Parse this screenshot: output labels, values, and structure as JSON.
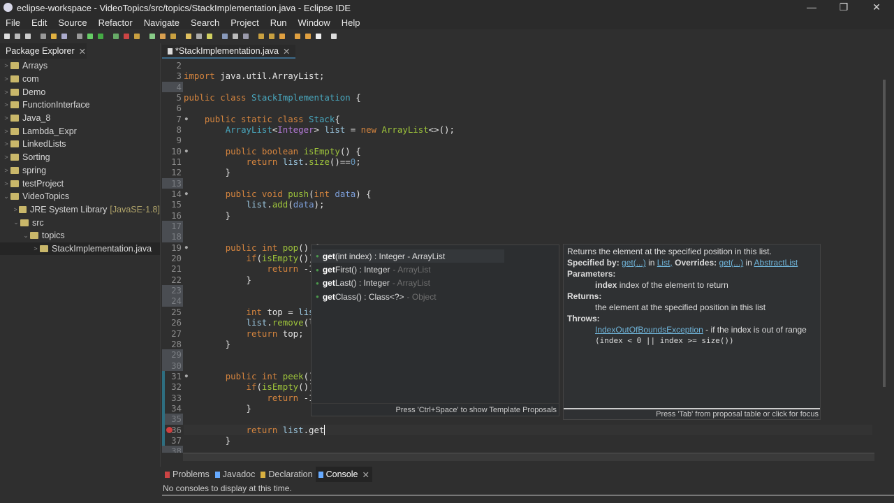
{
  "window": {
    "title": "eclipse-workspace - VideoTopics/src/topics/StackImplementation.java - Eclipse IDE",
    "minimize": "—",
    "restore": "❐",
    "close": "✕"
  },
  "menu": [
    "File",
    "Edit",
    "Source",
    "Refactor",
    "Navigate",
    "Search",
    "Project",
    "Run",
    "Window",
    "Help"
  ],
  "package_explorer": {
    "title": "Package Explorer",
    "items": [
      {
        "label": "Arrays",
        "depth": 0,
        "exp": ">"
      },
      {
        "label": "com",
        "depth": 0,
        "exp": ">"
      },
      {
        "label": "Demo",
        "depth": 0,
        "exp": ">"
      },
      {
        "label": "FunctionInterface",
        "depth": 0,
        "exp": ">"
      },
      {
        "label": "Java_8",
        "depth": 0,
        "exp": ">"
      },
      {
        "label": "Lambda_Expr",
        "depth": 0,
        "exp": ">"
      },
      {
        "label": "LinkedLists",
        "depth": 0,
        "exp": ">"
      },
      {
        "label": "Sorting",
        "depth": 0,
        "exp": ">"
      },
      {
        "label": "spring",
        "depth": 0,
        "exp": ">"
      },
      {
        "label": "testProject",
        "depth": 0,
        "exp": ">"
      },
      {
        "label": "VideoTopics",
        "depth": 0,
        "exp": "⌄"
      },
      {
        "label": "JRE System Library",
        "deco": "[JavaSE-1.8]",
        "depth": 1,
        "exp": ">"
      },
      {
        "label": "src",
        "depth": 1,
        "exp": "⌄"
      },
      {
        "label": "topics",
        "depth": 2,
        "exp": "⌄"
      },
      {
        "label": "StackImplementation.java",
        "depth": 3,
        "exp": ">"
      }
    ]
  },
  "editor": {
    "tab": "*StackImplementation.java",
    "first_line": 2,
    "highlighted_lines": [
      4,
      13,
      17,
      18,
      23,
      24,
      29,
      30,
      35,
      38
    ],
    "fold_markers": [
      7,
      10,
      14,
      19,
      31
    ],
    "error_line": 36,
    "lines": [
      [],
      [
        [
          "k",
          "import"
        ],
        [
          "p",
          " java.util.ArrayList;"
        ]
      ],
      [],
      [
        [
          "k",
          "public class "
        ],
        [
          "t",
          "StackImplementation"
        ],
        [
          "p",
          " {"
        ]
      ],
      [],
      [
        [
          "p",
          "    "
        ],
        [
          "k",
          "public static class "
        ],
        [
          "t",
          "Stack"
        ],
        [
          "p",
          "{"
        ]
      ],
      [
        [
          "p",
          "        "
        ],
        [
          "t",
          "ArrayList"
        ],
        [
          "p",
          "<"
        ],
        [
          "g",
          "Integer"
        ],
        [
          "p",
          "> "
        ],
        [
          "v",
          "list"
        ],
        [
          "p",
          " = "
        ],
        [
          "k",
          "new "
        ],
        [
          "m",
          "ArrayList"
        ],
        [
          "p",
          "<>();"
        ]
      ],
      [],
      [
        [
          "p",
          "        "
        ],
        [
          "k",
          "public boolean "
        ],
        [
          "m",
          "isEmpty"
        ],
        [
          "p",
          "() {"
        ]
      ],
      [
        [
          "p",
          "            "
        ],
        [
          "k",
          "return "
        ],
        [
          "v",
          "list"
        ],
        [
          "p",
          "."
        ],
        [
          "m",
          "size"
        ],
        [
          "p",
          "()=="
        ],
        [
          "n",
          "0"
        ],
        [
          "p",
          ";"
        ]
      ],
      [
        [
          "p",
          "        }"
        ]
      ],
      [],
      [
        [
          "p",
          "        "
        ],
        [
          "k",
          "public void "
        ],
        [
          "m",
          "push"
        ],
        [
          "p",
          "("
        ],
        [
          "k",
          "int "
        ],
        [
          "a",
          "data"
        ],
        [
          "p",
          ") {"
        ]
      ],
      [
        [
          "p",
          "            "
        ],
        [
          "v",
          "list"
        ],
        [
          "p",
          "."
        ],
        [
          "m",
          "add"
        ],
        [
          "p",
          "("
        ],
        [
          "a",
          "data"
        ],
        [
          "p",
          ");"
        ]
      ],
      [
        [
          "p",
          "        }"
        ]
      ],
      [],
      [],
      [
        [
          "p",
          "        "
        ],
        [
          "k",
          "public int "
        ],
        [
          "m",
          "pop"
        ],
        [
          "p",
          "() {"
        ]
      ],
      [
        [
          "p",
          "            "
        ],
        [
          "k",
          "if"
        ],
        [
          "p",
          "("
        ],
        [
          "m",
          "isEmpty"
        ],
        [
          "p",
          "())"
        ]
      ],
      [
        [
          "p",
          "                "
        ],
        [
          "k",
          "return "
        ],
        [
          "p",
          "-1"
        ]
      ],
      [
        [
          "p",
          "            }"
        ]
      ],
      [],
      [],
      [
        [
          "p",
          "            "
        ],
        [
          "k",
          "int "
        ],
        [
          "p",
          "top = "
        ],
        [
          "v",
          "lis"
        ]
      ],
      [
        [
          "p",
          "            "
        ],
        [
          "v",
          "list"
        ],
        [
          "p",
          "."
        ],
        [
          "m",
          "remove"
        ],
        [
          "p",
          "(l"
        ]
      ],
      [
        [
          "p",
          "            "
        ],
        [
          "k",
          "return "
        ],
        [
          "p",
          "top;"
        ]
      ],
      [
        [
          "p",
          "        }"
        ]
      ],
      [],
      [],
      [
        [
          "p",
          "        "
        ],
        [
          "k",
          "public int "
        ],
        [
          "m",
          "peek"
        ],
        [
          "p",
          "()"
        ]
      ],
      [
        [
          "p",
          "            "
        ],
        [
          "k",
          "if"
        ],
        [
          "p",
          "("
        ],
        [
          "m",
          "isEmpty"
        ],
        [
          "p",
          "())"
        ]
      ],
      [
        [
          "p",
          "                "
        ],
        [
          "k",
          "return "
        ],
        [
          "p",
          "-1"
        ]
      ],
      [
        [
          "p",
          "            }"
        ]
      ],
      [],
      [
        [
          "p",
          "            "
        ],
        [
          "k",
          "return "
        ],
        [
          "v",
          "list"
        ],
        [
          "p",
          ".get"
        ]
      ],
      [
        [
          "p",
          "        }"
        ]
      ],
      []
    ]
  },
  "completion": {
    "proposals": [
      {
        "name": "get",
        "rest": "(int index) : Integer - ArrayList",
        "qual": ""
      },
      {
        "name": "get",
        "rest": "First() : Integer",
        "qual": "- ArrayList"
      },
      {
        "name": "get",
        "rest": "Last() : Integer",
        "qual": "- ArrayList"
      },
      {
        "name": "get",
        "rest": "Class() : Class<?>",
        "qual": "- Object"
      }
    ],
    "footer": "Press 'Ctrl+Space' to show Template Proposals"
  },
  "javadoc": {
    "summary": "Returns the element at the specified position in this list.",
    "specified_by": "Specified by:",
    "get1": "get(...)",
    "in1": "in",
    "list": "List,",
    "overrides": "Overrides:",
    "get2": "get(...)",
    "in2": "in",
    "abstract_list": "AbstractList",
    "parameters": "Parameters:",
    "param_name": "index",
    "param_desc": "index of the element to return",
    "returns": "Returns:",
    "returns_desc": "the element at the specified position in this list",
    "throws": "Throws:",
    "exception": "IndexOutOfBoundsException",
    "exception_desc": "- if the index is out of range",
    "condition": "(index < 0 || index >= size())",
    "footer": "Press 'Tab' from proposal table or click for focus"
  },
  "bottom": {
    "tabs": [
      "Problems",
      "Javadoc",
      "Declaration",
      "Console"
    ],
    "active": "Console",
    "message": "No consoles to display at this time."
  }
}
